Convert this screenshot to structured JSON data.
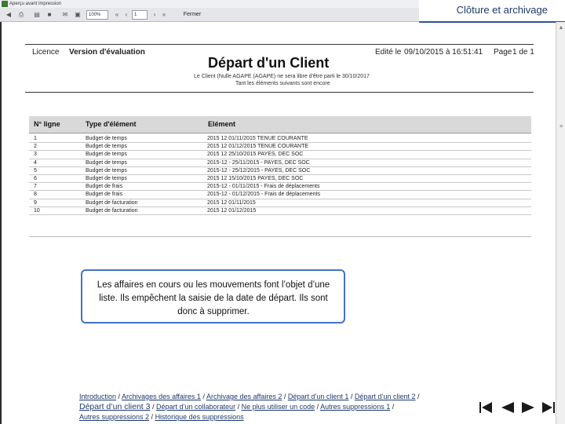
{
  "window": {
    "title": "Aperçu avant impression",
    "zoom": "100%",
    "page_input": "1",
    "close_label": "Fermer"
  },
  "header": {
    "section_title": "Clôture et archivage"
  },
  "report": {
    "license_label": "Licence",
    "license_value": "Version d'évaluation",
    "edited_label": "Edité le",
    "edited_value": "09/10/2015 à 16:51:41",
    "page_label": "Page",
    "page_value": "1 de 1",
    "title": "Départ d'un Client",
    "subtitle_line1": "Le Client (Nulle AGAPE (AGAPE) ne sera libre d'être parti le 30/10/2017",
    "subtitle_line2": "Tant les éléments suivants sont encore"
  },
  "table": {
    "headers": [
      "N° ligne",
      "Type d'élément",
      "Elément"
    ],
    "rows": [
      {
        "no": "1",
        "type": "Budget de temps",
        "element": "2015 12    01/11/2015    TENUE COURANTE"
      },
      {
        "no": "2",
        "type": "Budget de temps",
        "element": "2015 12    01/12/2015    TENUE COURANTE"
      },
      {
        "no": "3",
        "type": "Budget de temps",
        "element": "2015 12    25/10/2015    PAYES, DEC SOC"
      },
      {
        "no": "4",
        "type": "Budget de temps",
        "element": "2015-12  -  25/11/2015  -  PAYES, DEC SOC"
      },
      {
        "no": "5",
        "type": "Budget de temps",
        "element": "2015-12  -  25/12/2015  -  PAYES, DEC SOC"
      },
      {
        "no": "6",
        "type": "Budget de temps",
        "element": "2015 12    15/10/2015    PAYES, DEC SOC"
      },
      {
        "no": "7",
        "type": "Budget de frais",
        "element": "2015-12  -  01/11/2015  -  Frais de déplacements"
      },
      {
        "no": "8",
        "type": "Budget de frais",
        "element": "2015-12  -  01/12/2015  -  Frais de déplacements"
      },
      {
        "no": "9",
        "type": "Budget de facturation",
        "element": "2015 12    01/11/2015"
      },
      {
        "no": "10",
        "type": "Budget de facturation",
        "element": "2015 12    01/12/2015"
      }
    ]
  },
  "callout": {
    "text": "Les affaires en cours ou les mouvements font l’objet d’une liste. Ils empêchent la saisie de la date de départ. Ils sont donc à supprimer."
  },
  "links": [
    {
      "label": "Introduction",
      "current": false
    },
    {
      "label": "Archivages des affaires 1",
      "current": false
    },
    {
      "label": "Archivage des affaires 2",
      "current": false
    },
    {
      "label": "Départ d’un client 1",
      "current": false
    },
    {
      "label": "Départ d’un client 2",
      "current": false
    },
    {
      "label": "Départ d’un client 3",
      "current": true
    },
    {
      "label": "Départ d’un collaborateur",
      "current": false
    },
    {
      "label": "Ne plus utiliser un code",
      "current": false
    },
    {
      "label": "Autres suppressions 1",
      "current": false
    },
    {
      "label": "Autres suppressions 2",
      "current": false
    },
    {
      "label": "Historique des suppressions",
      "current": false
    }
  ],
  "colors": {
    "accent": "#2f5496",
    "callout_border": "#4472c4",
    "table_header_bg": "#d9d9d9"
  },
  "icons": {
    "first": "skip-first-icon",
    "prev": "previous-icon",
    "next": "next-icon",
    "last": "skip-last-icon"
  }
}
